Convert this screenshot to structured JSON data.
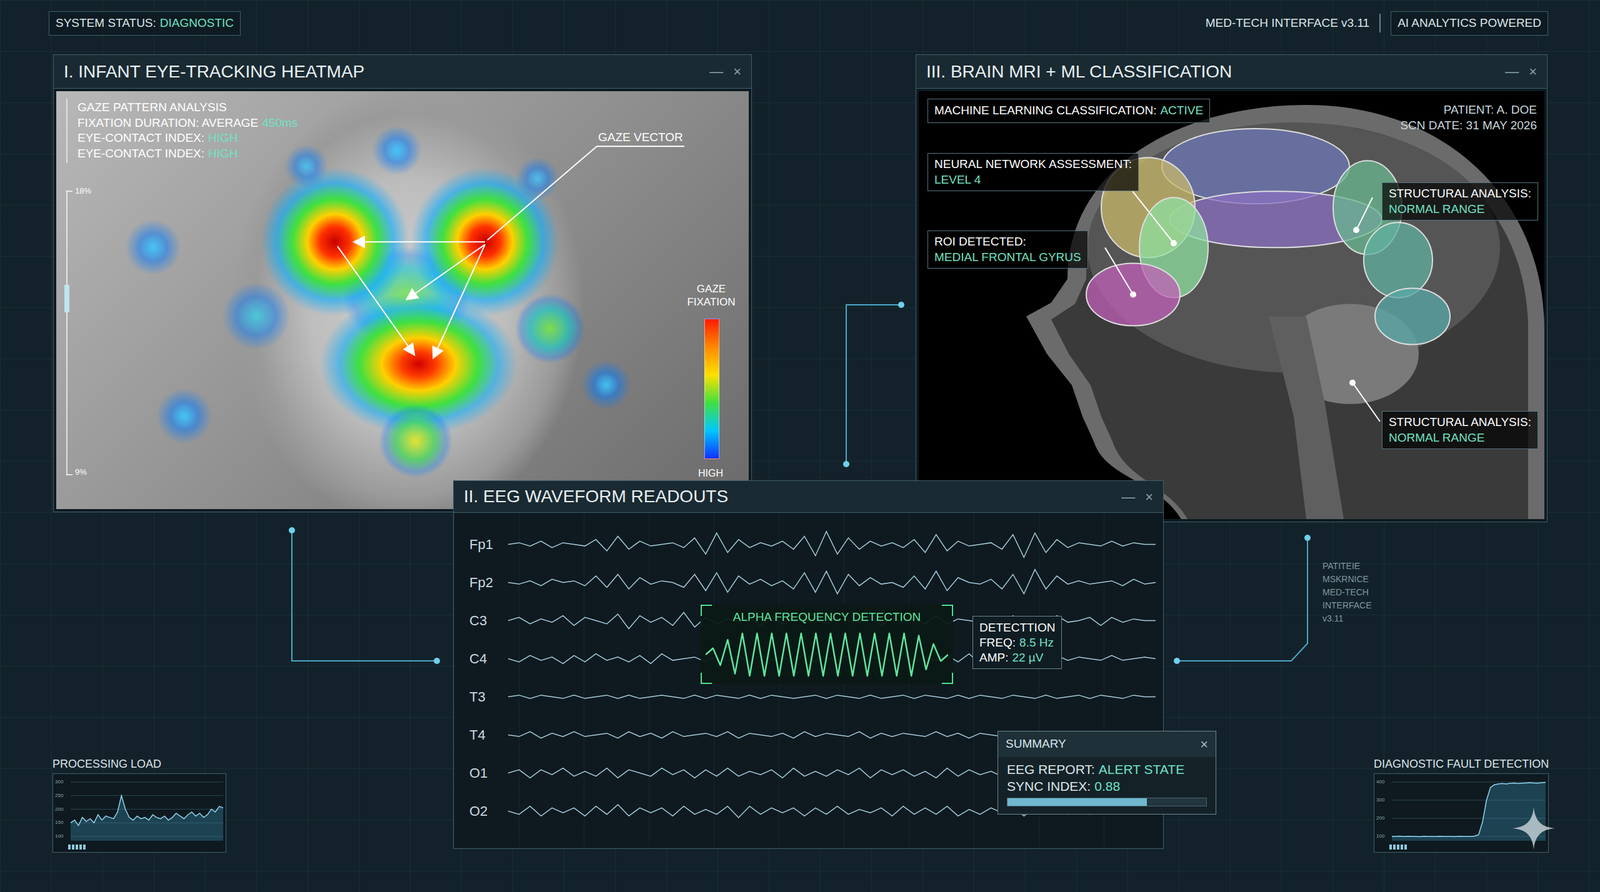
{
  "top_bar": {
    "status_label": "SYSTEM STATUS:",
    "status_value": "DIAGNOSTIC",
    "interface": "MED-TECH INTERFACE v3.11",
    "badge": "AI ANALYTICS POWERED"
  },
  "eye_panel": {
    "title": "I. INFANT EYE-TRACKING HEATMAP",
    "controls": [
      "—",
      "×"
    ],
    "analysis": {
      "heading": "GAZE PATTERN ANALYSIS",
      "lines": [
        {
          "label": "FIXATION DURATION: AVERAGE",
          "value": "450ms"
        },
        {
          "label": "EYE-CONTACT INDEX:",
          "value": "HIGH"
        },
        {
          "label": "EYE-CONTACT INDEX:",
          "value": "HIGH"
        }
      ]
    },
    "gaze_vector": "GAZE VECTOR",
    "scale": {
      "top": "18%",
      "bottom": "9%",
      "level": 0.62
    },
    "legend": {
      "title": "GAZE FIXATION",
      "label": "HIGH"
    }
  },
  "mri_panel": {
    "title": "III. BRAIN MRI + ML CLASSIFICATION",
    "controls": [
      "—",
      "×"
    ],
    "classification": {
      "label": "MACHINE LEARNING CLASSIFICATION:",
      "value": "ACTIVE"
    },
    "patient": "PATIENT: A. DOE",
    "scan_date": "SCN DATE: 31 MAY 2026",
    "annotations": [
      {
        "label": "NEURAL NETWORK ASSESSMENT:",
        "value": "LEVEL 4"
      },
      {
        "label": "ROI DETECTED:",
        "value": "MEDIAL FRONTAL GYRUS"
      },
      {
        "label": "STRUCTURAL ANALYSIS:",
        "value": "NORMAL RANGE"
      },
      {
        "label": "STRUCTURAL ANALYSIS:",
        "value": "NORMAL RANGE"
      }
    ]
  },
  "eeg_panel": {
    "title": "II. EEG WAVEFORM READOUTS",
    "controls": [
      "—",
      "×"
    ],
    "channels": [
      {
        "name": "Fp1",
        "values": [
          0,
          1,
          -1,
          2,
          -2,
          1,
          0,
          -1,
          3,
          -4,
          5,
          -3,
          2,
          -1,
          0,
          1,
          -2,
          4,
          -6,
          7,
          -5,
          3,
          -2,
          1,
          -1,
          2,
          -3,
          5,
          -7,
          8,
          -6,
          4,
          -3,
          2,
          -1,
          1,
          -2,
          3,
          -5,
          6,
          -4,
          2,
          -1,
          0,
          1,
          -3,
          6,
          -8,
          7,
          -5,
          3,
          -2,
          1,
          0,
          -1,
          2,
          -1,
          1,
          0,
          0
        ]
      },
      {
        "name": "Fp2",
        "values": [
          0,
          -1,
          1,
          -2,
          2,
          0,
          1,
          -2,
          4,
          -3,
          5,
          -4,
          3,
          -1,
          1,
          0,
          -3,
          5,
          -5,
          6,
          -6,
          4,
          -1,
          2,
          -2,
          1,
          -4,
          6,
          -6,
          7,
          -7,
          5,
          -2,
          3,
          -1,
          0,
          -3,
          4,
          -4,
          7,
          -5,
          3,
          0,
          -1,
          2,
          -4,
          5,
          -7,
          8,
          -4,
          4,
          -1,
          1,
          -1,
          0,
          1,
          -2,
          2,
          -1,
          0
        ]
      },
      {
        "name": "C3",
        "values": [
          0,
          2,
          -2,
          1,
          -1,
          3,
          -3,
          2,
          0,
          -2,
          4,
          -5,
          3,
          -1,
          2,
          -3,
          5,
          -4,
          2,
          -2,
          1,
          -1,
          2,
          -3,
          3,
          -2,
          1,
          -1,
          2,
          -2,
          1,
          0,
          -1,
          2,
          -3,
          2,
          -1,
          1,
          -2,
          3,
          -2,
          1,
          0,
          -1,
          2,
          -4,
          3,
          -2,
          1,
          -2,
          3,
          -1,
          0,
          2,
          -3,
          2,
          -1,
          1,
          0,
          0
        ]
      },
      {
        "name": "C4",
        "values": [
          0,
          -2,
          2,
          -1,
          1,
          -3,
          2,
          -2,
          3,
          -1,
          1,
          -2,
          2,
          -3,
          3,
          -1,
          0,
          1,
          -2,
          2,
          -1,
          2,
          -3,
          2,
          -1,
          1,
          -2,
          3,
          -2,
          1,
          -1,
          2,
          -2,
          1,
          0,
          -1,
          3,
          -2,
          1,
          -1,
          2,
          -2,
          3,
          -3,
          2,
          -1,
          1,
          -2,
          4,
          -3,
          2,
          -1,
          1,
          0,
          -1,
          2,
          -1,
          0,
          1,
          0
        ]
      },
      {
        "name": "T3",
        "values": [
          0,
          1,
          -1,
          1,
          0,
          -1,
          1,
          -1,
          0,
          1,
          -1,
          1,
          -1,
          0,
          1,
          0,
          -1,
          1,
          -1,
          1,
          0,
          -1,
          1,
          -1,
          1,
          0,
          -1,
          0,
          1,
          -1,
          1,
          0,
          -1,
          1,
          -1,
          0,
          1,
          -1,
          1,
          0,
          -1,
          1,
          -1,
          1,
          0,
          -1,
          1,
          0,
          -1,
          1,
          -1,
          0,
          1,
          -1,
          1,
          0,
          -1,
          1,
          0,
          0
        ]
      },
      {
        "name": "T4",
        "values": [
          0,
          -1,
          2,
          -2,
          1,
          -1,
          2,
          -1,
          0,
          1,
          -2,
          2,
          -1,
          1,
          -2,
          2,
          -1,
          0,
          1,
          -1,
          2,
          -2,
          1,
          0,
          -1,
          1,
          -2,
          2,
          -1,
          1,
          0,
          -1,
          2,
          -2,
          1,
          -1,
          1,
          0,
          -1,
          2,
          -1,
          1,
          -2,
          1,
          0,
          -1,
          2,
          -1,
          1,
          -1,
          0,
          1,
          -2,
          2,
          -1,
          1,
          0,
          -1,
          1,
          0
        ]
      },
      {
        "name": "O1",
        "values": [
          0,
          2,
          -3,
          2,
          -1,
          3,
          -2,
          1,
          -2,
          3,
          -3,
          2,
          0,
          -2,
          3,
          -1,
          2,
          -3,
          2,
          -2,
          3,
          -2,
          1,
          -1,
          2,
          -3,
          3,
          -2,
          1,
          -2,
          2,
          -1,
          3,
          -3,
          2,
          -1,
          2,
          -2,
          1,
          -3,
          3,
          -2,
          2,
          -1,
          1,
          -2,
          3,
          -2,
          2,
          -3,
          2,
          -1,
          1,
          -2,
          2,
          -1,
          1,
          -1,
          0,
          0
        ]
      },
      {
        "name": "O2",
        "values": [
          0,
          -2,
          3,
          -3,
          2,
          -1,
          2,
          -3,
          3,
          -2,
          4,
          -3,
          2,
          -1,
          2,
          -3,
          3,
          -2,
          1,
          -2,
          3,
          -4,
          3,
          -2,
          2,
          -1,
          2,
          -3,
          2,
          -2,
          3,
          -2,
          1,
          -1,
          2,
          -3,
          3,
          -2,
          2,
          -2,
          3,
          -3,
          1,
          -2,
          2,
          -1,
          3,
          -3,
          2,
          -1,
          2,
          -2,
          3,
          -2,
          1,
          -1,
          2,
          -1,
          1,
          0
        ]
      }
    ],
    "alpha": {
      "label": "ALPHA FREQUENCY DETECTION",
      "values": [
        0,
        3,
        -5,
        7,
        -9,
        10,
        -10,
        10,
        -10,
        10,
        -10,
        10,
        -10,
        10,
        -10,
        10,
        -10,
        10,
        -10,
        10,
        -10,
        10,
        -10,
        10,
        -10,
        10,
        -10,
        10,
        -10,
        9,
        -7,
        5,
        -3,
        0
      ]
    },
    "detection": {
      "title": "DETECTTION",
      "freq_label": "FREQ:",
      "freq": "8.5 Hz",
      "amp_label": "AMP:",
      "amp": "22 µV"
    },
    "summary": {
      "title": "SUMMARY",
      "close": "×",
      "report_label": "EEG REPORT:",
      "report": "ALERT STATE",
      "sync_label": "SYNC INDEX:",
      "sync": "0.88",
      "level": 0.7
    }
  },
  "processing_load": {
    "title": "PROCESSING LOAD",
    "ticks": [
      "300",
      "250",
      "200",
      "150",
      "100"
    ],
    "values": [
      150,
      160,
      140,
      170,
      155,
      165,
      150,
      180,
      160,
      175,
      170,
      165,
      190,
      250,
      200,
      170,
      160,
      175,
      165,
      170,
      160,
      180,
      170,
      165,
      175,
      160,
      170,
      185,
      175,
      165,
      180,
      190,
      175,
      185,
      170,
      180,
      200,
      190,
      210,
      205
    ]
  },
  "fault_detection": {
    "title": "DIAGNOSTIC FAULT DETECTION",
    "ticks": [
      "400",
      "300",
      "200",
      "100"
    ],
    "values": [
      100,
      100,
      102,
      99,
      101,
      100,
      100,
      98,
      101,
      100,
      100,
      99,
      101,
      100,
      100,
      100,
      99,
      101,
      100,
      100,
      100,
      102,
      110,
      180,
      300,
      370,
      385,
      390,
      392,
      390,
      393,
      395,
      392,
      394,
      395,
      396,
      395,
      394,
      396,
      398
    ]
  },
  "side_note": [
    "PATITEIE",
    "MSKRNICE",
    "MED-TECH",
    "INTERFACE",
    "v3.11"
  ]
}
